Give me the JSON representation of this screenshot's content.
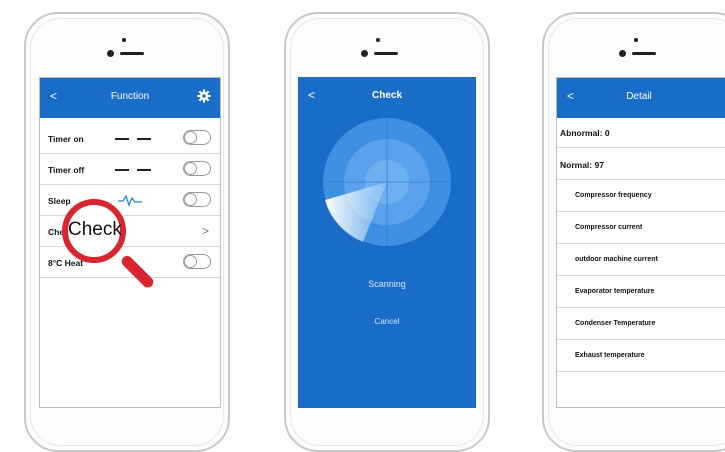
{
  "phone1": {
    "nav": {
      "back_glyph": "<",
      "title": "Function",
      "settings_icon": "gear-icon"
    },
    "rows": [
      {
        "label": "Timer on",
        "value": "— —",
        "control": "toggle"
      },
      {
        "label": "Timer off",
        "value": "— —",
        "control": "toggle"
      },
      {
        "label": "Sleep",
        "value": "sleep-curve-icon",
        "control": "toggle"
      },
      {
        "label": "Che",
        "control": "chevron",
        "chevron": ">"
      },
      {
        "label": "8°C Heat",
        "control": "toggle"
      }
    ],
    "magnifier": {
      "text": "Check",
      "color": "#d7262f"
    }
  },
  "phone2": {
    "nav": {
      "back_glyph": "<",
      "title": "Check"
    },
    "status": "Scanning",
    "cancel": "Cancel"
  },
  "phone3": {
    "nav": {
      "back_glyph": "<",
      "title": "Detail"
    },
    "abnormal": "Abnormal: 0",
    "normal": "Normal: 97",
    "items": [
      "Compressor frequency",
      "Compressor current",
      "outdoor machine current",
      "Evaporator temperature",
      "Condenser Temperature",
      "Exhaust temperature"
    ]
  },
  "colors": {
    "accent": "#1a6cc9",
    "magnifier": "#d7262f"
  }
}
